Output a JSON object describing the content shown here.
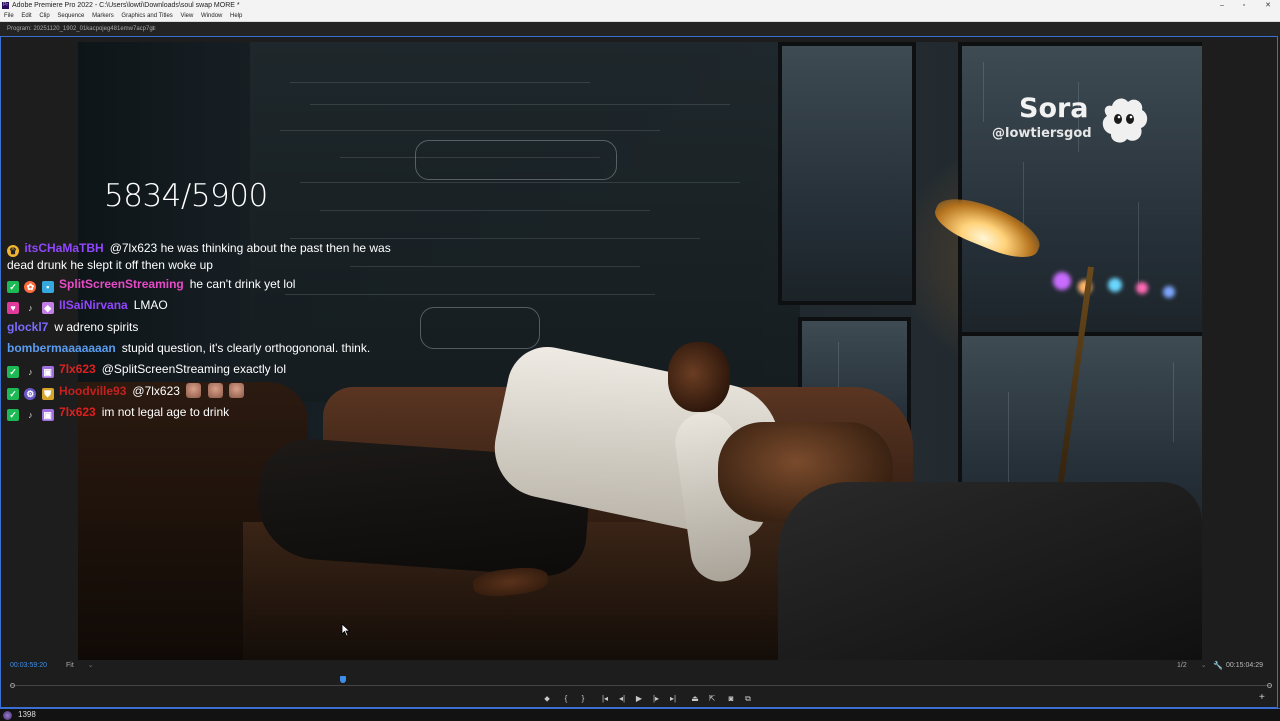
{
  "window": {
    "title": "Adobe Premiere Pro 2022 - C:\\Users\\lowti\\Downloads\\soul swap MORE *",
    "app_icon_text": "Pr",
    "controls": [
      "–",
      "▫",
      "✕"
    ]
  },
  "menu": [
    "File",
    "Edit",
    "Clip",
    "Sequence",
    "Markers",
    "Graphics and Titles",
    "View",
    "Window",
    "Help"
  ],
  "monitor": {
    "label": "Program: 20251120_1902_01kacpojeg481emw7acp7gt",
    "menu_glyph": "≡"
  },
  "video": {
    "counter": "5834/5900",
    "watermark_name": "Sora",
    "watermark_handle": "@lowtiersgod",
    "watermark_icon": "sora-cloud-icon"
  },
  "chat": [
    {
      "badges": [
        "crown"
      ],
      "user": "itsCHaMaTBH",
      "user_color": "#9146ff",
      "text": "@7lx623 he was thinking about the past then he was",
      "text2": "dead drunk he slept it off then woke up"
    },
    {
      "badges": [
        "check",
        "gift",
        "sub"
      ],
      "user": "SplitScreenStreaming",
      "user_color": "#e84bc8",
      "text": "he can't drink yet lol"
    },
    {
      "badges": [
        "heart",
        "mic",
        "bit"
      ],
      "user": "IISaiNirvana",
      "user_color": "#9146ff",
      "text": "LMAO"
    },
    {
      "badges": [],
      "user": "glockl7",
      "user_color": "#7a6cff",
      "text": "w adreno spirits"
    },
    {
      "badges": [],
      "user": "bombermaaaaaaan",
      "user_color": "#5a9cf0",
      "text": "stupid question, it's clearly orthogononal. think."
    },
    {
      "badges": [
        "check",
        "mic",
        "sub"
      ],
      "user": "7lx623",
      "user_color": "#e02020",
      "text": "@SplitScreenStreaming exactly lol"
    },
    {
      "badges": [
        "check",
        "gear",
        "shield"
      ],
      "user": "Hoodville93",
      "user_color": "#c42020",
      "text": "@7lx623",
      "emotes": 3
    },
    {
      "badges": [
        "check",
        "mic",
        "sub"
      ],
      "user": "7lx623",
      "user_color": "#e02020",
      "text": "im not legal age to drink"
    }
  ],
  "controls": {
    "timecode_left": "00:03:59:20",
    "fit": "Fit",
    "resolution": "1/2",
    "timecode_right": "00:15:04:29",
    "playhead_fraction": 0.264,
    "transport_buttons": [
      "add-marker",
      "mark-in",
      "mark-out",
      "go-to-in",
      "step-back",
      "play",
      "step-forward",
      "go-to-out",
      "lift",
      "extract",
      "export-frame",
      "comparison-view"
    ],
    "add_button": "+",
    "accent": "#3d8ee8"
  },
  "taskbar": {
    "count": "1398"
  }
}
